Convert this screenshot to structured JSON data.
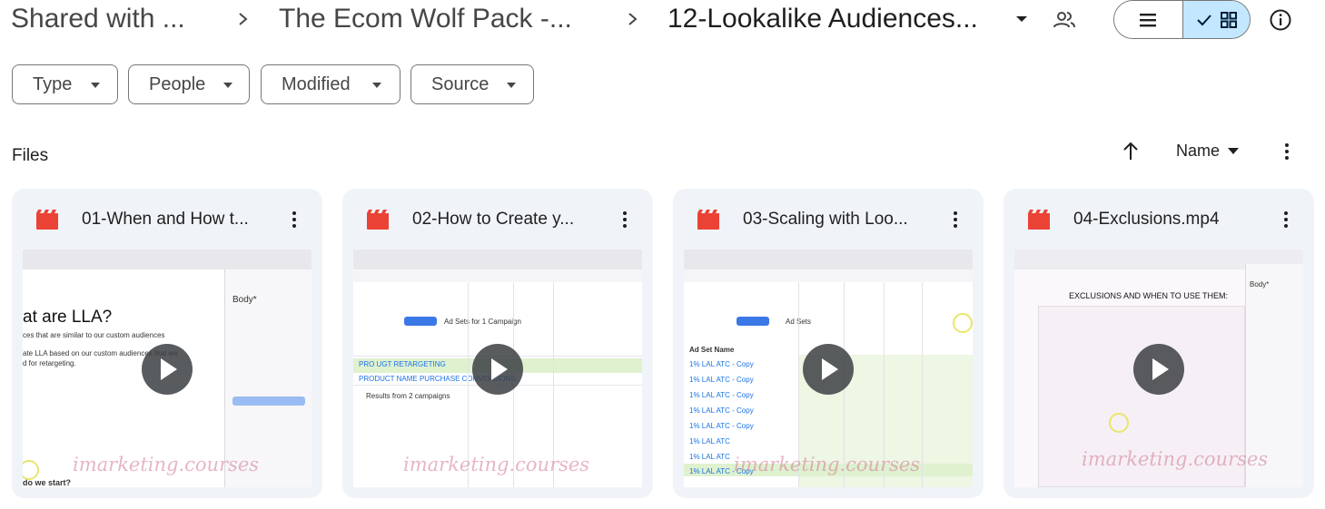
{
  "breadcrumb": {
    "items": [
      {
        "label": "Shared with ..."
      },
      {
        "label": "The Ecom Wolf Pack -..."
      },
      {
        "label": "12-Lookalike Audiences..."
      }
    ]
  },
  "header": {
    "share_icon": "people-icon",
    "view_list_icon": "list-view-icon",
    "view_grid_icon": "grid-view-icon",
    "info_icon": "info-icon"
  },
  "filters": [
    {
      "label": "Type"
    },
    {
      "label": "People"
    },
    {
      "label": "Modified"
    },
    {
      "label": "Source"
    }
  ],
  "files_section": {
    "title": "Files",
    "sort_label": "Name"
  },
  "files": [
    {
      "name": "01-When and How t...",
      "thumb_heading": "at are LLA?",
      "thumb_line1": "ces that are similar to our custom audiences",
      "thumb_line2": "ate LLA based on our custom audiences that we",
      "thumb_line3": "d for retargeting.",
      "thumb_footer": "do we start?",
      "thumb_panel_label": "Body*"
    },
    {
      "name": "02-How to Create y...",
      "thumb_tab": "Ad Sets for 1 Campaign",
      "thumb_row1": "PRO UGT RETARGETING",
      "thumb_row2": "PRODUCT NAME PURCHASE CONVERSIONS",
      "thumb_row3": "Results from 2 campaigns"
    },
    {
      "name": "03-Scaling with Loo...",
      "thumb_tab": "Ad Sets",
      "thumb_col": "Ad Set Name",
      "thumb_rows": [
        "1% LAL ATC - Copy",
        "1% LAL ATC - Copy",
        "1% LAL ATC - Copy",
        "1% LAL ATC - Copy",
        "1% LAL ATC - Copy",
        "1% LAL ATC",
        "1% LAL ATC",
        "1% LAL ATC - Copy"
      ]
    },
    {
      "name": "04-Exclusions.mp4",
      "thumb_heading": "EXCLUSIONS AND WHEN TO USE THEM:",
      "thumb_panel_label": "Body*"
    }
  ],
  "watermark": "imarketing.courses",
  "colors": {
    "accent_toggle": "#c2e7ff",
    "card_bg": "#f0f4f9",
    "video_icon": "#ea4335"
  }
}
